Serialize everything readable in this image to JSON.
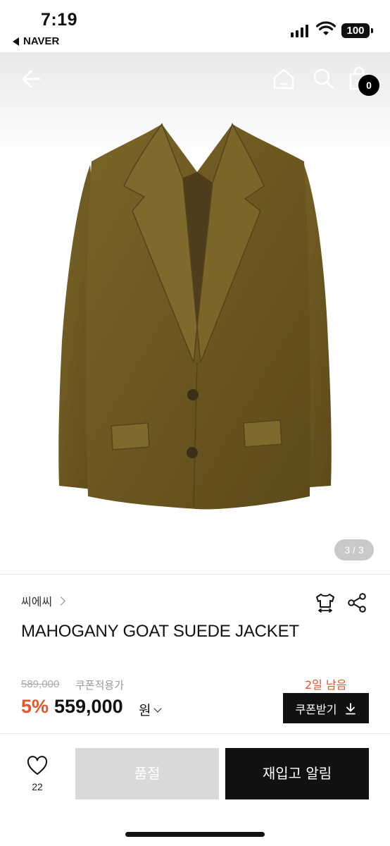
{
  "status_bar": {
    "time": "7:19",
    "back_app": "NAVER",
    "battery": "100"
  },
  "header": {
    "cart_count": "0",
    "icons": [
      "back-arrow-icon",
      "home-icon",
      "search-icon",
      "shopping-bag-icon"
    ]
  },
  "gallery": {
    "indicator": "3 / 3",
    "current": 3,
    "total": 3
  },
  "product": {
    "brand": "씨에씨",
    "name": "MAHOGANY GOAT SUEDE JACKET",
    "original_price": "589,000",
    "coupon_note": "쿠폰적용가",
    "discount": "5%",
    "price": "559,000",
    "currency": "원",
    "days_left": "2일 남음",
    "coupon_button": "쿠폰받기"
  },
  "bottom_bar": {
    "like_count": "22",
    "soldout_label": "품절",
    "restock_label": "재입고 알림"
  },
  "colors": {
    "accent": "#e2562b",
    "jacket": "#6e5a22",
    "button_dark": "#111111",
    "button_disabled": "#d9d9d9"
  }
}
